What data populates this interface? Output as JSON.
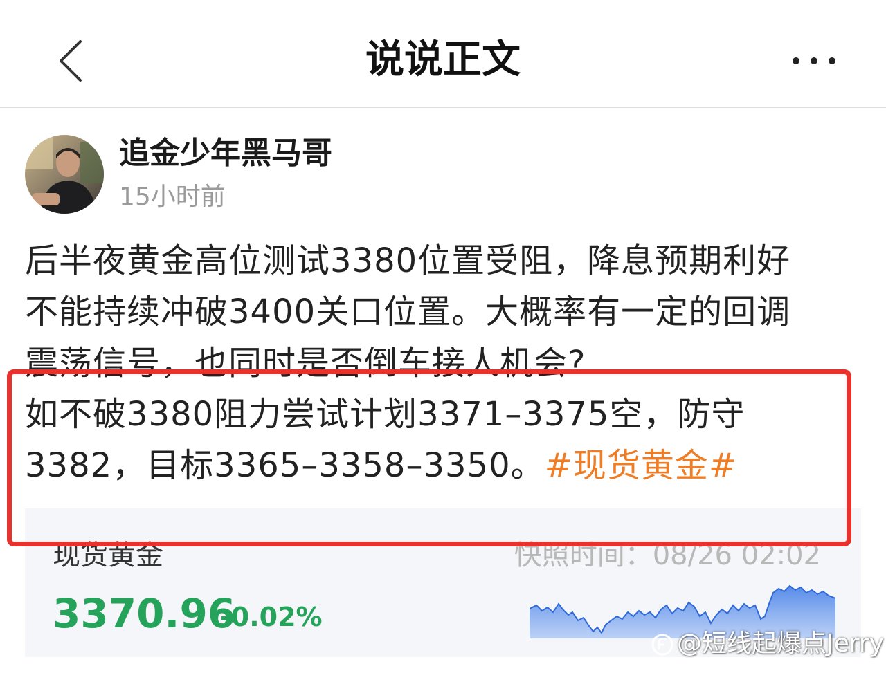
{
  "nav": {
    "title": "说说正文",
    "back_icon": "chevron-left-icon",
    "more_icon": "more-dots-icon"
  },
  "post": {
    "author": "追金少年黑马哥",
    "time": "15小时前",
    "lines": [
      "后半夜黄金高位测试3380位置受阻，降息预期利好",
      "不能持续冲破3400关口位置。大概率有一定的回调",
      "震荡信号，也同时是否倒车接人机会?",
      "如不破3380阻力尝试计划3371–3375空，防守",
      "3382，目标3365–3358–3350。"
    ],
    "hashtag": "#现货黄金#"
  },
  "quote": {
    "name": "现货黄金",
    "snapshot": "快照时间：08/26 02:02",
    "price": "3370.96",
    "change": "-0.02%",
    "price_color": "#25a35a"
  },
  "highlight_color": "#e8322d",
  "hashtag_color": "#ee7d25",
  "watermark": "@短线起爆点Jerry"
}
